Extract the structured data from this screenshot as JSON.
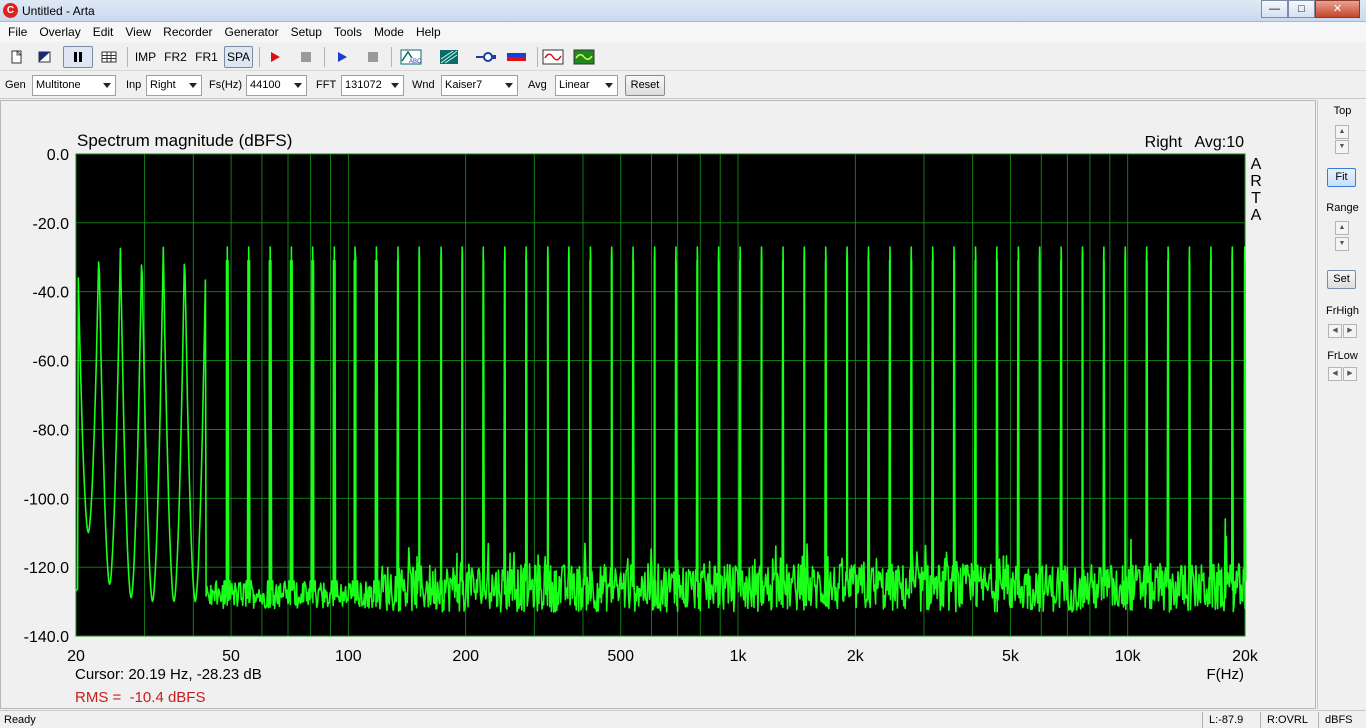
{
  "window": {
    "title": "Untitled - Arta",
    "app_icon": "arta-icon",
    "controls": {
      "minimize": "—",
      "maximize": "□",
      "close": "✕"
    }
  },
  "menu": [
    "File",
    "Overlay",
    "Edit",
    "View",
    "Recorder",
    "Generator",
    "Setup",
    "Tools",
    "Mode",
    "Help"
  ],
  "toolbar": {
    "imp": "IMP",
    "fr2": "FR2",
    "fr1": "FR1",
    "spa": "SPA",
    "icons": [
      "new-file-icon",
      "open-icon",
      "pause-icon",
      "table-icon",
      "record-icon",
      "stop-icon",
      "play-icon",
      "stop-play-icon",
      "abc-scope-icon",
      "spectrogram-icon",
      "probe-icon",
      "battery-icon",
      "signal-wave-icon",
      "gen-wave-icon"
    ]
  },
  "controls": {
    "gen": {
      "label": "Gen",
      "value": "Multitone"
    },
    "inp": {
      "label": "Inp",
      "value": "Right"
    },
    "fs": {
      "label": "Fs(Hz)",
      "value": "44100"
    },
    "fft": {
      "label": "FFT",
      "value": "131072"
    },
    "wnd": {
      "label": "Wnd",
      "value": "Kaiser7"
    },
    "avg": {
      "label": "Avg",
      "value": "Linear"
    },
    "reset": "Reset"
  },
  "side": {
    "top": "Top",
    "fit": "Fit",
    "range": "Range",
    "set": "Set",
    "frhigh": "FrHigh",
    "frlow": "FrLow",
    "up": "▲",
    "down": "▼",
    "left": "◀",
    "right": "▶"
  },
  "status": {
    "ready": "Ready",
    "l": "L:-87.9",
    "r": "R:OVRL",
    "unit": "dBFS"
  },
  "plot": {
    "cursor": "Cursor: 20.19 Hz, -28.23 dB",
    "rms": "RMS =  -10.4 dBFS",
    "channel_avg": "Right   Avg:10",
    "brand": [
      "A",
      "R",
      "T",
      "A"
    ],
    "colors": {
      "background": "#000000",
      "grid": "#168a16",
      "trace": "#19ff19",
      "rms": "#c81e1e"
    }
  },
  "chart_data": {
    "type": "line",
    "title": "Spectrum magnitude (dBFS)",
    "xlabel": "F(Hz)",
    "ylabel": "",
    "x_scale": "log",
    "xlim": [
      20,
      20000
    ],
    "ylim": [
      -140,
      0
    ],
    "x_ticks": [
      20,
      50,
      100,
      200,
      500,
      1000,
      2000,
      5000,
      10000,
      20000
    ],
    "x_tick_labels": [
      "20",
      "50",
      "100",
      "200",
      "500",
      "1k",
      "2k",
      "5k",
      "10k",
      "20k"
    ],
    "y_ticks": [
      0,
      -20,
      -40,
      -60,
      -80,
      -100,
      -120,
      -140
    ],
    "y_tick_labels": [
      "0.0",
      "-20.0",
      "-40.0",
      "-60.0",
      "-80.0",
      "-100.0",
      "-120.0",
      "-140.0"
    ],
    "grid": true,
    "series": [
      {
        "tones_hz": [
          20.2,
          22.9,
          26.0,
          29.5,
          33.5,
          38.0,
          43.1,
          48.9,
          55.5,
          63.0,
          71.4,
          81.0,
          92.0,
          104,
          118,
          134,
          152,
          173,
          196,
          222,
          252,
          286,
          325,
          368,
          418,
          474,
          538,
          611,
          693,
          786,
          892,
          1012,
          1149,
          1304,
          1479,
          1679,
          1905,
          2162,
          2453,
          2784,
          3159,
          3585,
          4068,
          4617,
          5239,
          5945,
          6746,
          7656,
          8687,
          9858,
          11187,
          12695,
          14406,
          16348,
          18551,
          19980
        ],
        "tone_level_db": -27,
        "noise_floor_db": -126,
        "valley_minima": [
          [
            21.4,
            -110
          ],
          [
            24.3,
            -125
          ],
          [
            27.6,
            -129
          ],
          [
            31.3,
            -130
          ],
          [
            35.5,
            -130
          ],
          [
            40.3,
            -130
          ]
        ],
        "spurs": [
          [
            150,
            -117
          ],
          [
            190,
            -116
          ],
          [
            260,
            -116
          ],
          [
            700,
            -118
          ],
          [
            1700,
            -117
          ],
          [
            10200,
            -112
          ],
          [
            12100,
            -119
          ],
          [
            17800,
            -106
          ]
        ]
      }
    ]
  }
}
